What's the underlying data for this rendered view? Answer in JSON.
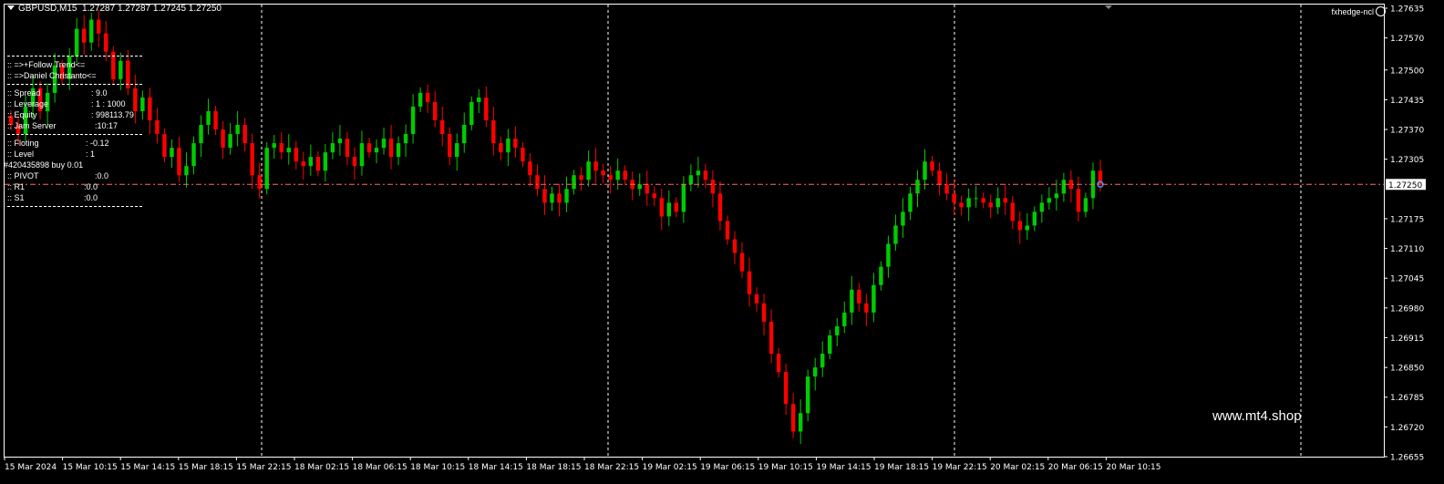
{
  "header": {
    "symbol": "GBPUSD,M15",
    "ohlc": "1.27287 1.27287 1.27245 1.27250"
  },
  "account": {
    "name": "fxhedge-ncl"
  },
  "watermark": "www.mt4.shop",
  "panel": {
    "title1": ":: =>+Follow Trend<=",
    "title2": ":: =>Daniel Christanto<=",
    "rows1": [
      {
        "label": ":: Spread",
        "value": ": 9.0"
      },
      {
        "label": ":: Leverage",
        "value": ": 1 : 1000"
      },
      {
        "label": ":: Equity",
        "value": ": 998113.79"
      },
      {
        "label": ":: Jam Server",
        "value": ":10:17"
      }
    ],
    "rows2": [
      {
        "label": ":: Floting",
        "value": ": -0.12"
      },
      {
        "label": ":: Level",
        "value": ": 1"
      }
    ],
    "order": "#420435898 buy 0.01",
    "rows3": [
      {
        "label": ":: PIVOT",
        "value": ":0.0"
      },
      {
        "label": ":: R1",
        "value": ":0.0"
      },
      {
        "label": ":: S1",
        "value": ":0.0"
      }
    ]
  },
  "colors": {
    "background": "#000000",
    "bull": "#00cc00",
    "bear": "#ff0000",
    "text": "#ffffff",
    "bidline": "#ff6666",
    "grid": "#ffffff"
  },
  "chart_data": {
    "type": "candlestick",
    "ylim": [
      1.26655,
      1.27635
    ],
    "y_ticks": [
      1.27635,
      1.2757,
      1.275,
      1.27435,
      1.2737,
      1.27305,
      1.27175,
      1.2711,
      1.27045,
      1.2698,
      1.26915,
      1.2685,
      1.26785,
      1.2672,
      1.26655
    ],
    "current_price": "1.27250",
    "x_ticks": [
      "15 Mar 2024",
      "15 Mar 10:15",
      "15 Mar 14:15",
      "15 Mar 18:15",
      "15 Mar 22:15",
      "18 Mar 02:15",
      "18 Mar 06:15",
      "18 Mar 10:15",
      "18 Mar 14:15",
      "18 Mar 18:15",
      "18 Mar 22:15",
      "19 Mar 02:15",
      "19 Mar 06:15",
      "19 Mar 10:15",
      "19 Mar 14:15",
      "19 Mar 18:15",
      "19 Mar 22:15",
      "20 Mar 02:15",
      "20 Mar 06:15",
      "20 Mar 10:15"
    ],
    "closes": [
      1.2738,
      1.2736,
      1.2742,
      1.2746,
      1.2741,
      1.2745,
      1.2751,
      1.2748,
      1.2753,
      1.2759,
      1.2756,
      1.2761,
      1.2758,
      1.2754,
      1.2748,
      1.2752,
      1.2746,
      1.2741,
      1.2744,
      1.2739,
      1.2736,
      1.2731,
      1.2733,
      1.2727,
      1.2729,
      1.2734,
      1.2738,
      1.2741,
      1.2737,
      1.2733,
      1.2736,
      1.2738,
      1.2734,
      1.2727,
      1.2724,
      1.2733,
      1.2734,
      1.2732,
      1.2733,
      1.273,
      1.2729,
      1.2731,
      1.2728,
      1.2732,
      1.2734,
      1.2735,
      1.2731,
      1.2729,
      1.2734,
      1.2732,
      1.2733,
      1.2735,
      1.2731,
      1.2734,
      1.2736,
      1.2742,
      1.2745,
      1.2743,
      1.2739,
      1.2736,
      1.2731,
      1.2734,
      1.2738,
      1.2743,
      1.2744,
      1.2739,
      1.2734,
      1.2732,
      1.2735,
      1.2733,
      1.273,
      1.2727,
      1.2724,
      1.2721,
      1.2723,
      1.2721,
      1.2724,
      1.2727,
      1.2726,
      1.273,
      1.2728,
      1.2727,
      1.2726,
      1.2728,
      1.2726,
      1.2724,
      1.2725,
      1.2723,
      1.2722,
      1.2718,
      1.2721,
      1.2719,
      1.2725,
      1.2727,
      1.2728,
      1.2726,
      1.2723,
      1.2717,
      1.2713,
      1.271,
      1.2706,
      1.2701,
      1.2699,
      1.2695,
      1.2688,
      1.2684,
      1.2677,
      1.2671,
      1.2675,
      1.2683,
      1.2685,
      1.2688,
      1.2692,
      1.2694,
      1.2697,
      1.2702,
      1.2699,
      1.2697,
      1.2703,
      1.2707,
      1.2712,
      1.2716,
      1.2719,
      1.2723,
      1.2726,
      1.273,
      1.2728,
      1.2725,
      1.2723,
      1.2721,
      1.272,
      1.2722,
      1.2722,
      1.2721,
      1.272,
      1.2722,
      1.2721,
      1.2717,
      1.2715,
      1.2716,
      1.2719,
      1.2721,
      1.2722,
      1.2723,
      1.2726,
      1.2724,
      1.2719,
      1.2722,
      1.2728,
      1.2725
    ]
  }
}
